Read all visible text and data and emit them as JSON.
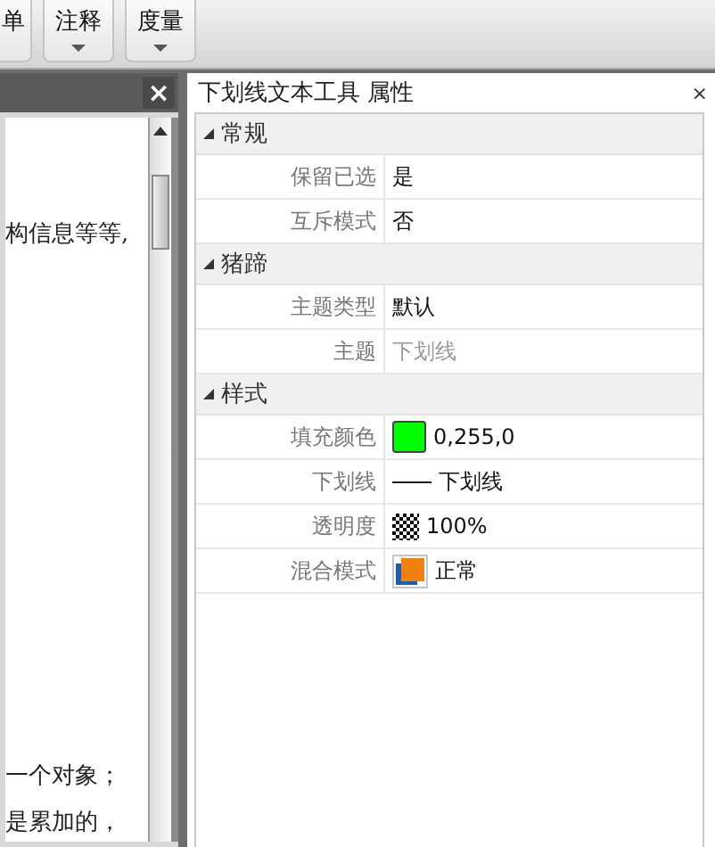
{
  "toolbar": {
    "buttons": [
      {
        "label": "单",
        "dropdown": false
      },
      {
        "label": "注释",
        "dropdown": true
      },
      {
        "label": "度量",
        "dropdown": true
      }
    ]
  },
  "document": {
    "top_lines": [
      "构信息等等,"
    ],
    "bottom_lines": [
      "一个对象；",
      "是累加的，"
    ]
  },
  "properties": {
    "title": "下划线文本工具 属性",
    "close": "×",
    "categories": [
      {
        "name": "常规",
        "expanded": true,
        "rows": [
          {
            "label": "保留已选",
            "value": "是",
            "kind": "text",
            "disabled": false
          },
          {
            "label": "互斥模式",
            "value": "否",
            "kind": "text",
            "disabled": false
          }
        ]
      },
      {
        "name": "猪蹄",
        "expanded": true,
        "rows": [
          {
            "label": "主题类型",
            "value": "默认",
            "kind": "text",
            "disabled": false
          },
          {
            "label": "主题",
            "value": "下划线",
            "kind": "text",
            "disabled": true
          }
        ]
      },
      {
        "name": "样式",
        "expanded": true,
        "rows": [
          {
            "label": "填充颜色",
            "value": "0,255,0",
            "kind": "color",
            "color": "#00ff00",
            "disabled": false
          },
          {
            "label": "下划线",
            "value": "下划线",
            "kind": "line",
            "disabled": false
          },
          {
            "label": "透明度",
            "value": "100%",
            "kind": "pattern",
            "disabled": false
          },
          {
            "label": "混合模式",
            "value": "正常",
            "kind": "blend",
            "disabled": false
          }
        ]
      }
    ]
  },
  "left_pane": {
    "close": "×"
  }
}
